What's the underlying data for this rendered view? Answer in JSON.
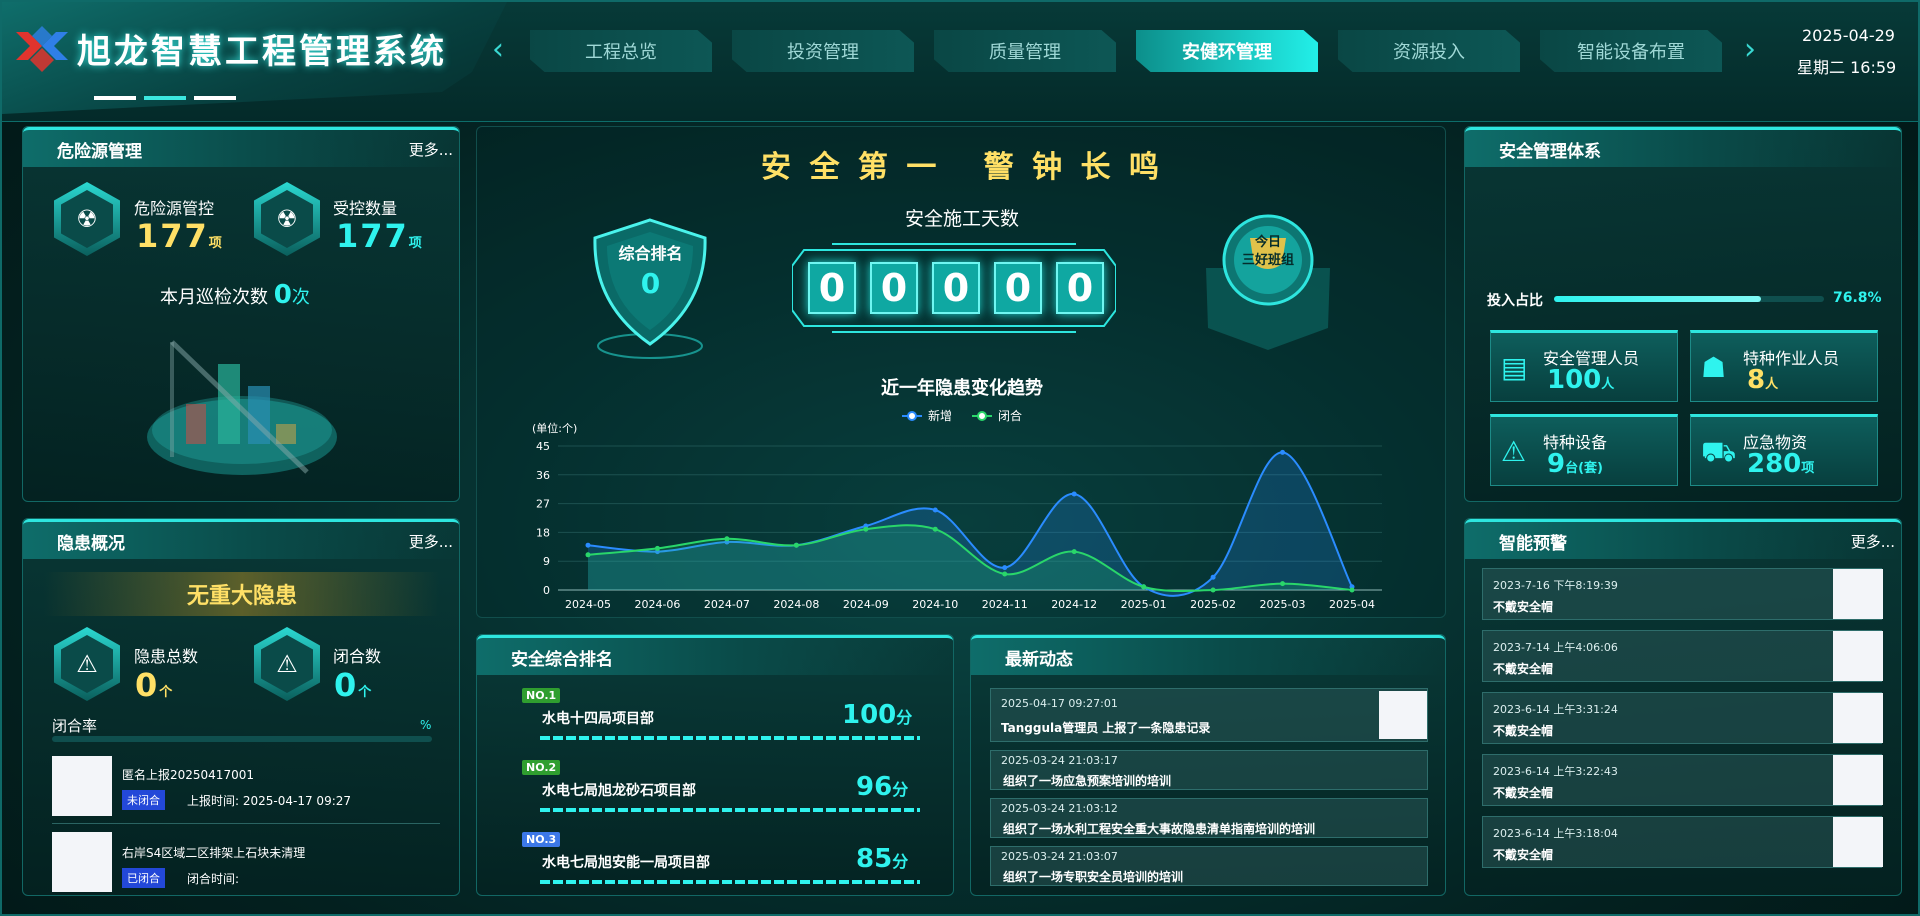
{
  "app": {
    "title": "旭龙智慧工程管理系统",
    "date": "2025-04-29",
    "time": "星期二  16:59"
  },
  "nav": {
    "tabs": [
      "工程总览",
      "投资管理",
      "质量管理",
      "安健环管理",
      "资源投入",
      "智能设备布置"
    ],
    "active_index": 3
  },
  "hazard": {
    "title": "危险源管理",
    "more": "更多...",
    "controlled_label": "危险源管控",
    "controlled_value": "177",
    "controlled_unit": "项",
    "count_label": "受控数量",
    "count_value": "177",
    "count_unit": "项",
    "patrol_label": "本月巡检次数",
    "patrol_value": "0",
    "patrol_unit": "次"
  },
  "hidden": {
    "title": "隐患概况",
    "more": "更多...",
    "banner": "无重大隐患",
    "total_label": "隐患总数",
    "total_value": "0",
    "total_unit": "个",
    "closed_label": "闭合数",
    "closed_value": "0",
    "closed_unit": "个",
    "rate_label": "闭合率",
    "rate_unit": "%",
    "items": [
      {
        "title": "匿名上报20250417001",
        "status": "未闭合",
        "time_label": "上报时间:",
        "time": "2025-04-17 09:27"
      },
      {
        "title": "右岸S4区域二区排架上石块未清理",
        "status": "已闭合",
        "time_label": "闭合时间:",
        "time": ""
      }
    ]
  },
  "center": {
    "slogan": "安 全 第 一   警 钟 长 鸣",
    "rank_label": "综合排名",
    "rank_value": "0",
    "days_label": "安全施工天数",
    "days_digits": [
      "0",
      "0",
      "0",
      "0",
      "0"
    ],
    "trophy_line1": "今日",
    "trophy_line2": "三好班组"
  },
  "chart_data": {
    "type": "line",
    "title": "近一年隐患变化趋势",
    "unit_label": "(单位:个)",
    "categories": [
      "2024-05",
      "2024-06",
      "2024-07",
      "2024-08",
      "2024-09",
      "2024-10",
      "2024-11",
      "2024-12",
      "2025-01",
      "2025-02",
      "2025-03",
      "2025-04"
    ],
    "series": [
      {
        "name": "新增",
        "values": [
          14,
          12,
          15,
          14,
          20,
          25,
          7,
          30,
          1,
          4,
          43,
          1
        ],
        "color": "#2a8cff"
      },
      {
        "name": "闭合",
        "values": [
          11,
          13,
          16,
          14,
          19,
          19,
          5,
          12,
          1,
          0,
          2,
          0
        ],
        "color": "#29d66a"
      }
    ],
    "yticks": [
      0,
      9,
      18,
      27,
      36,
      45
    ],
    "ylim": [
      0,
      45
    ],
    "legend": "top-center",
    "grid": true
  },
  "ranking": {
    "title": "安全综合排名",
    "items": [
      {
        "badge": "NO.1",
        "name": "水电十四局项目部",
        "score": "100",
        "unit": "分",
        "color": "#2f9e2f"
      },
      {
        "badge": "NO.2",
        "name": "水电七局旭龙砂石项目部",
        "score": "96",
        "unit": "分",
        "color": "#2f9e2f"
      },
      {
        "badge": "NO.3",
        "name": "水电七局旭安能一局项目部",
        "score": "85",
        "unit": "分",
        "color": "#3c78e8"
      }
    ]
  },
  "news": {
    "title": "最新动态",
    "items": [
      {
        "time": "2025-04-17 09:27:01",
        "text": "Tanggula管理员 上报了一条隐患记录"
      },
      {
        "time": "2025-03-24 21:03:17",
        "text": "组织了一场应急预案培训的培训"
      },
      {
        "time": "2025-03-24 21:03:12",
        "text": "组织了一场水利工程安全重大事故隐患清单指南培训的培训"
      },
      {
        "time": "2025-03-24 21:03:07",
        "text": "组织了一场专职安全员培训的培训"
      }
    ]
  },
  "system": {
    "title": "安全管理体系",
    "invest_label": "投入占比",
    "invest_value": "76.8%",
    "invest_fraction": 0.768,
    "cards": [
      {
        "label": "安全管理人员",
        "value": "100",
        "unit": "人",
        "icon": "document-icon"
      },
      {
        "label": "特种作业人员",
        "value": "8",
        "unit": "人",
        "icon": "worker-icon"
      },
      {
        "label": "特种设备",
        "value": "9",
        "unit": "台(套)",
        "icon": "equipment-icon"
      },
      {
        "label": "应急物资",
        "value": "280",
        "unit": "项",
        "icon": "supplies-icon"
      }
    ]
  },
  "warning": {
    "title": "智能预警",
    "more": "更多...",
    "items": [
      {
        "time": "2023-7-16 下午8:19:39",
        "text": "不戴安全帽"
      },
      {
        "time": "2023-7-14 上午4:06:06",
        "text": "不戴安全帽"
      },
      {
        "time": "2023-6-14 上午3:31:24",
        "text": "不戴安全帽"
      },
      {
        "time": "2023-6-14 上午3:22:43",
        "text": "不戴安全帽"
      },
      {
        "time": "2023-6-14 上午3:18:04",
        "text": "不戴安全帽"
      }
    ]
  }
}
